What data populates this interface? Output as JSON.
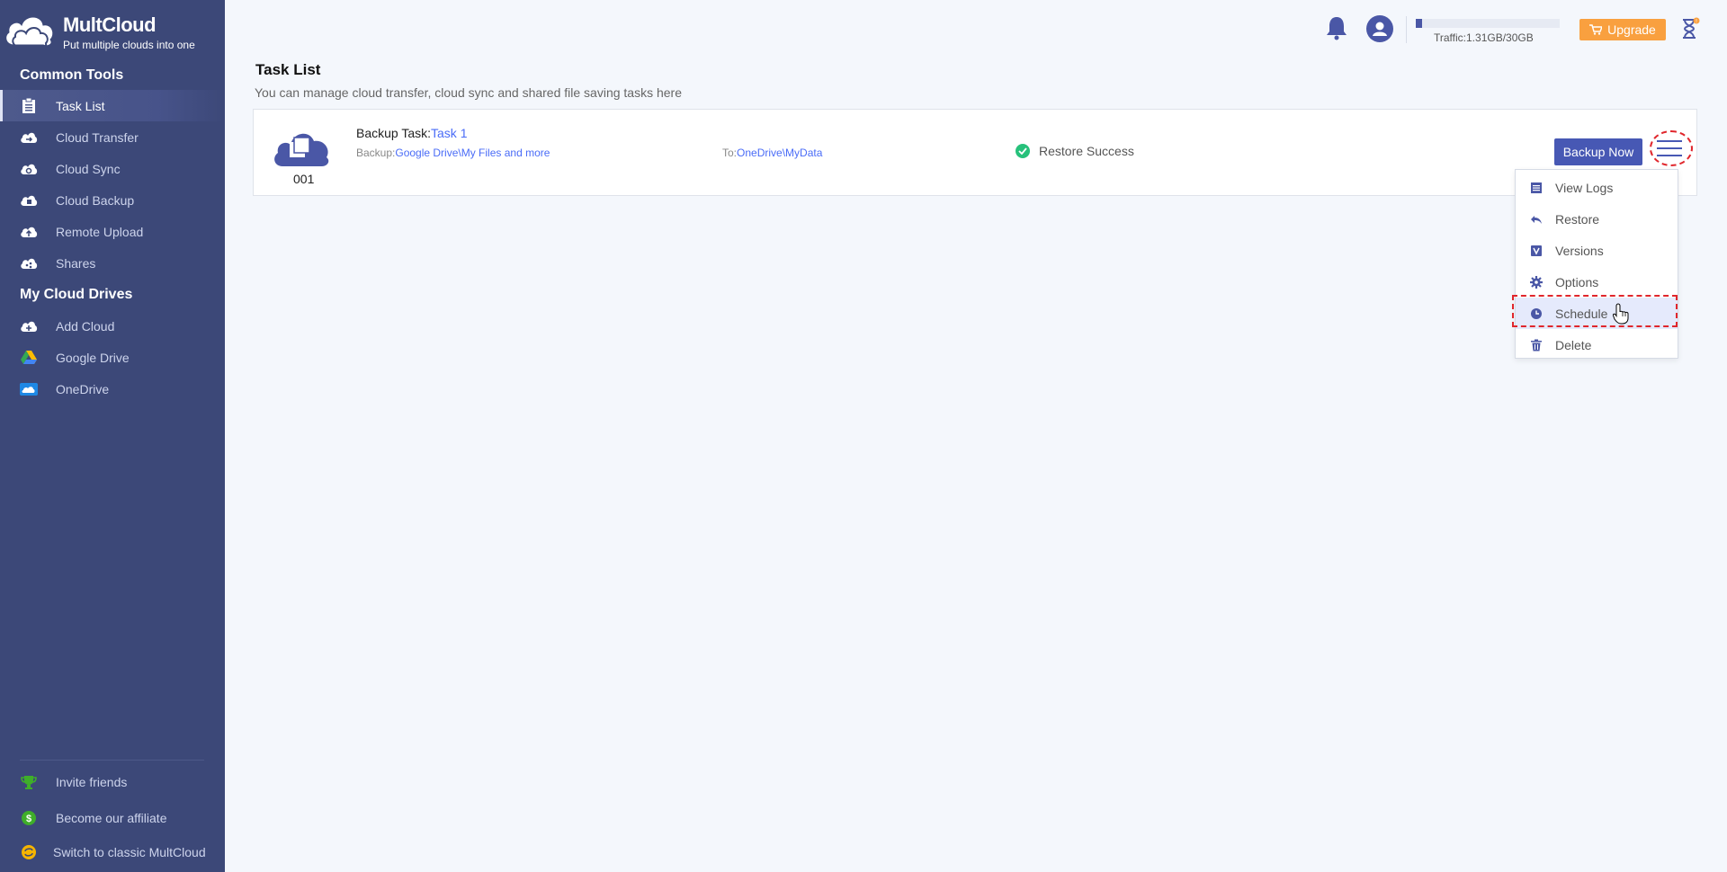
{
  "app": {
    "name": "MultCloud",
    "tagline": "Put multiple clouds into one"
  },
  "sidebar": {
    "common_tools_heading": "Common Tools",
    "common_tools": [
      {
        "label": "Task List",
        "icon": "clipboard-icon",
        "active": true
      },
      {
        "label": "Cloud Transfer",
        "icon": "cloud-transfer-icon"
      },
      {
        "label": "Cloud Sync",
        "icon": "cloud-sync-icon"
      },
      {
        "label": "Cloud Backup",
        "icon": "cloud-backup-icon"
      },
      {
        "label": "Remote Upload",
        "icon": "cloud-upload-icon"
      },
      {
        "label": "Shares",
        "icon": "cloud-share-icon"
      }
    ],
    "my_cloud_drives_heading": "My Cloud Drives",
    "my_cloud_drives": [
      {
        "label": "Add Cloud",
        "icon": "add-cloud-icon"
      },
      {
        "label": "Google Drive",
        "icon": "google-drive-icon"
      },
      {
        "label": "OneDrive",
        "icon": "onedrive-icon"
      }
    ],
    "bottom": [
      {
        "label": "Invite friends",
        "icon": "trophy-icon"
      },
      {
        "label": "Become our affiliate",
        "icon": "dollar-icon"
      },
      {
        "label": "Switch to classic MultCloud",
        "icon": "switch-icon"
      }
    ]
  },
  "header": {
    "traffic_text": "Traffic:1.31GB/30GB",
    "traffic_used_fraction": 0.044,
    "upgrade_label": "Upgrade",
    "notification_badge": "!",
    "colors": {
      "upgrade": "#f9a03f",
      "primary": "#4758b4",
      "sidebar": "#3c4878",
      "success": "#27c17b",
      "link": "#4a6cf7"
    }
  },
  "main": {
    "title": "Task List",
    "subtitle": "You can manage cloud transfer, cloud sync and shared file saving tasks here",
    "task": {
      "number": "001",
      "type_label": "Backup Task:",
      "name": "Task 1",
      "from_label": "Backup:",
      "from_value": "Google Drive\\My Files and more",
      "to_label": "To:",
      "to_value": "OneDrive\\MyData",
      "status": "Restore Success",
      "backup_now_label": "Backup Now"
    },
    "dropdown": [
      {
        "label": "View Logs",
        "icon": "list-icon"
      },
      {
        "label": "Restore",
        "icon": "undo-icon"
      },
      {
        "label": "Versions",
        "icon": "versions-icon"
      },
      {
        "label": "Options",
        "icon": "gear-icon"
      },
      {
        "label": "Schedule",
        "icon": "clock-icon",
        "hover": true
      },
      {
        "label": "Delete",
        "icon": "trash-icon"
      }
    ]
  }
}
